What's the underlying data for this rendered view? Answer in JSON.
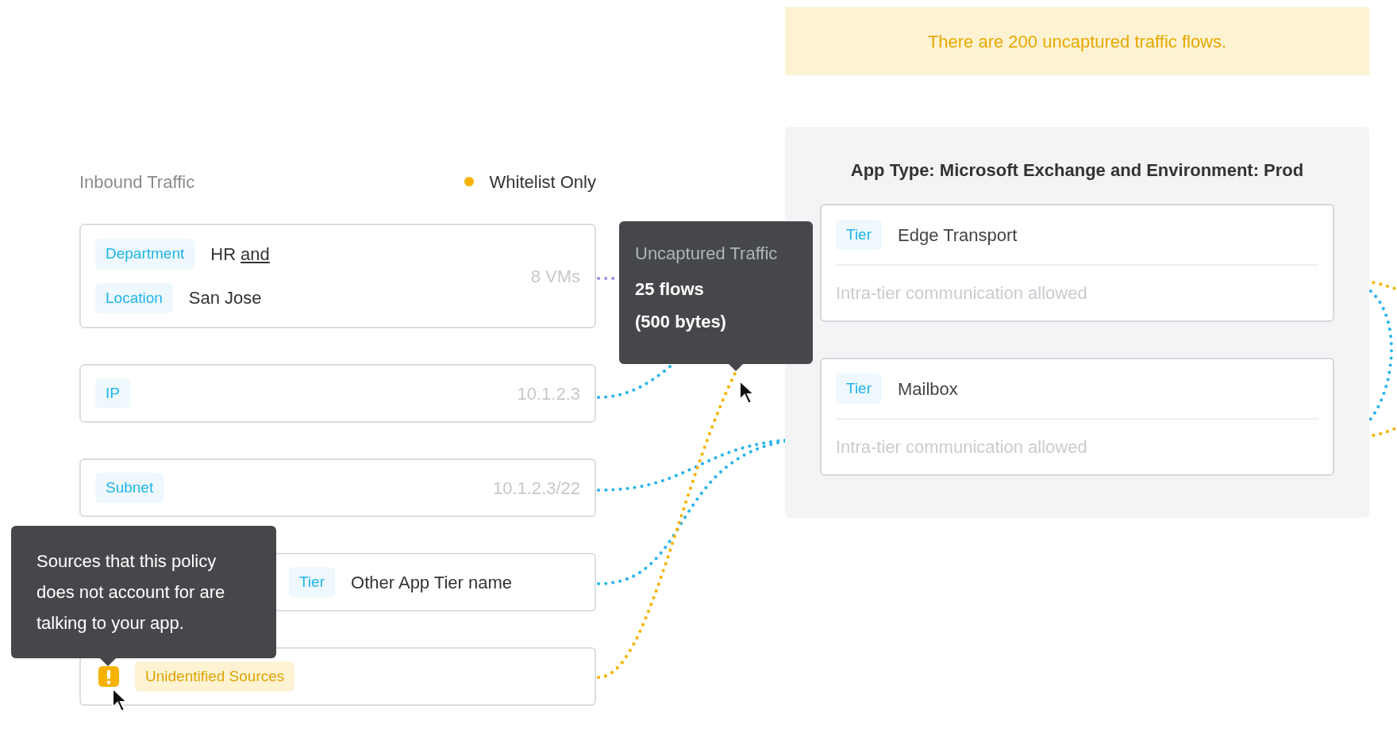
{
  "banner": {
    "text": "There are 200 uncaptured traffic flows."
  },
  "inbound": {
    "title": "Inbound Traffic",
    "mode": "Whitelist Only"
  },
  "sources": [
    {
      "kind": "attributes",
      "rows": [
        {
          "label": "Department",
          "value": "HR",
          "link": "and"
        },
        {
          "label": "Location",
          "value": "San Jose"
        }
      ],
      "count": "8 VMs"
    },
    {
      "kind": "tag",
      "label": "IP",
      "value": "10.1.2.3"
    },
    {
      "kind": "tag",
      "label": "Subnet",
      "value": "10.1.2.3/22"
    },
    {
      "kind": "tier",
      "label": "Tier",
      "name": "Other App Tier name"
    },
    {
      "kind": "warning",
      "label": "Unidentified Sources"
    }
  ],
  "sources_tooltip": {
    "text": "Sources that this policy does not account for are talking to your app."
  },
  "traffic_tooltip": {
    "title": "Uncaptured Traffic",
    "flows": "25 flows",
    "bytes": "(500 bytes)"
  },
  "app": {
    "title": "App Type: Microsoft Exchange and Environment: Prod",
    "tiers": [
      {
        "label": "Tier",
        "name": "Edge Transport",
        "note": "Intra-tier communication allowed"
      },
      {
        "label": "Tier",
        "name": "Mailbox",
        "note": "Intra-tier communication allowed"
      }
    ]
  }
}
